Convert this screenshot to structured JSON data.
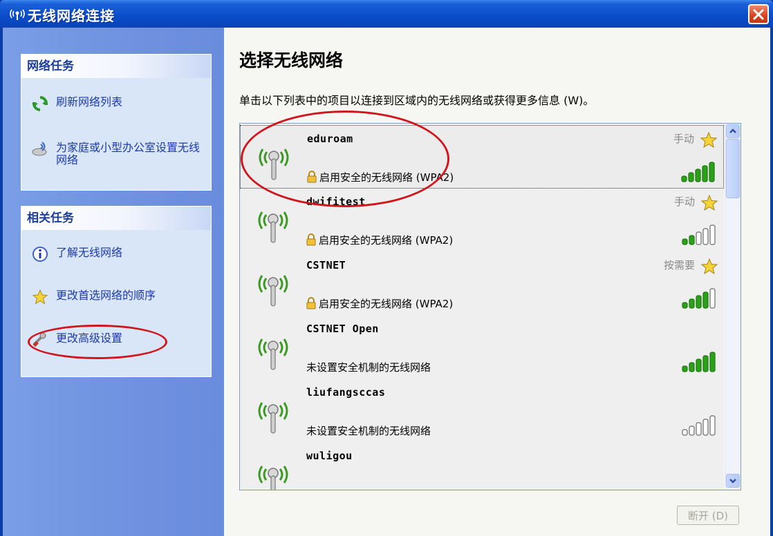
{
  "window": {
    "title": "无线网络连接"
  },
  "network_tasks": {
    "header": "网络任务",
    "items": [
      {
        "label": "刷新网络列表",
        "icon": "refresh-icon"
      },
      {
        "label": "为家庭或小型办公室设置无线网络",
        "icon": "wireless-setup-icon"
      }
    ]
  },
  "related_tasks": {
    "header": "相关任务",
    "items": [
      {
        "label": "了解无线网络",
        "icon": "info-icon"
      },
      {
        "label": "更改首选网络的顺序",
        "icon": "star-icon"
      },
      {
        "label": "更改高级设置",
        "icon": "settings-icon"
      }
    ]
  },
  "main": {
    "heading": "选择无线网络",
    "instruction": "单击以下列表中的项目以连接到区域内的无线网络或获得更多信息 (W)。",
    "disconnect_label": "断开 (D)"
  },
  "networks": [
    {
      "name": "eduroam",
      "mode": "手动",
      "security": "启用安全的无线网络 (WPA2)",
      "secured": true,
      "signal_bars": 5,
      "selected": true
    },
    {
      "name": "dwifitest",
      "mode": "手动",
      "security": "启用安全的无线网络 (WPA2)",
      "secured": true,
      "signal_bars": 2,
      "selected": false
    },
    {
      "name": "CSTNET",
      "mode": "按需要",
      "security": "启用安全的无线网络 (WPA2)",
      "secured": true,
      "signal_bars": 4,
      "selected": false
    },
    {
      "name": "CSTNET Open",
      "mode": "",
      "security": "未设置安全机制的无线网络",
      "secured": false,
      "signal_bars": 5,
      "selected": false
    },
    {
      "name": "liufangsccas",
      "mode": "",
      "security": "未设置安全机制的无线网络",
      "secured": false,
      "signal_bars": 0,
      "selected": false
    },
    {
      "name": "wuligou",
      "mode": "",
      "security": "",
      "secured": false,
      "signal_bars": 0,
      "selected": false
    }
  ],
  "colors": {
    "titlebar": "#0a4cc8",
    "task_link": "#1d3aa8",
    "signal_on": "#2da01a",
    "highlight_ellipse": "#d0161c"
  }
}
